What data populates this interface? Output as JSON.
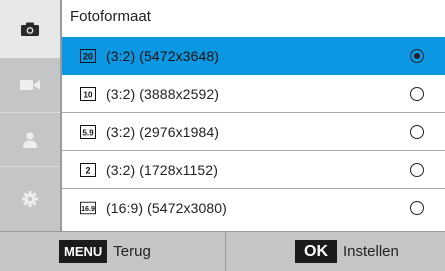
{
  "menu": {
    "title": "Fotoformaat",
    "items": [
      {
        "icon": "20m-icon",
        "label": "(3:2) (5472x3648)",
        "selected": true
      },
      {
        "icon": "10.1m-icon",
        "label": "(3:2) (3888x2592)",
        "selected": false
      },
      {
        "icon": "5.9m-icon",
        "label": "(3:2) (2976x1984)",
        "selected": false
      },
      {
        "icon": "2m-icon",
        "label": "(3:2) (1728x1152)",
        "selected": false
      },
      {
        "icon": "16.9m-icon",
        "label": "(16:9) (5472x3080)",
        "selected": false
      }
    ]
  },
  "sidebar": {
    "tabs": [
      {
        "icon": "camera-icon",
        "active": true
      },
      {
        "icon": "video-camera-icon",
        "active": false
      },
      {
        "icon": "person-icon",
        "active": false
      },
      {
        "icon": "gear-icon",
        "active": false
      }
    ]
  },
  "bottom": {
    "back_key": "MENU",
    "back_label": "Terug",
    "ok_key": "OK",
    "ok_label": "Instellen"
  },
  "colors": {
    "selected_row": "#0b97e1",
    "sidebar": "#c4c5c7"
  }
}
